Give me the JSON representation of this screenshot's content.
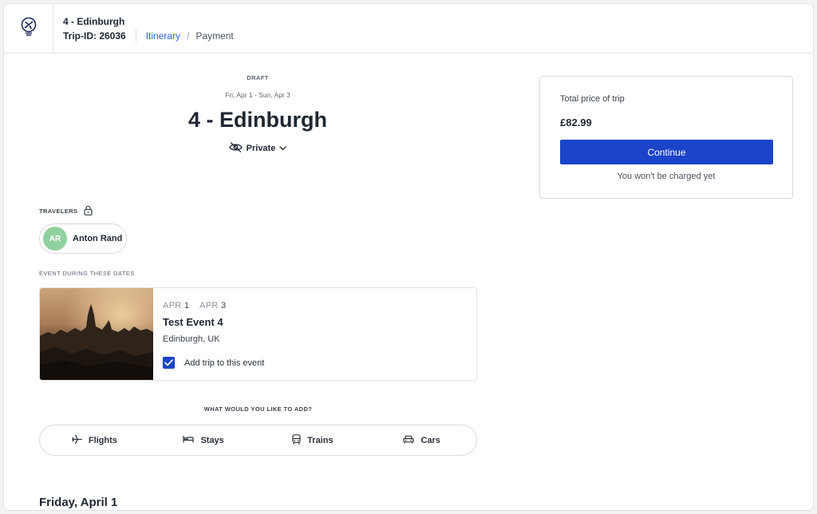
{
  "header": {
    "trip_name": "4 - Edinburgh",
    "trip_id": "Trip-ID: 26036",
    "breadcrumb": {
      "itinerary": "Itinerary",
      "separator": "/",
      "payment": "Payment"
    },
    "logo_icon": "plane-lightbulb-icon"
  },
  "hero": {
    "status": "DRAFT",
    "dates": "Fri, Apr 1 - Sun, Apr 3",
    "title": "4 - Edinburgh",
    "privacy": "Private"
  },
  "travelers": {
    "label": "TRAVELERS",
    "items": [
      {
        "initials": "AR",
        "name": "Anton Rand",
        "avatar_color": "#8fd19e"
      }
    ]
  },
  "event": {
    "label": "EVENT DURING THESE DATES",
    "start_month": "APR",
    "start_day": "1",
    "end_month": "APR",
    "end_day": "3",
    "title": "Test Event 4",
    "location": "Edinburgh, UK",
    "add_label": "Add trip to this event",
    "add_checked": true
  },
  "add": {
    "question": "WHAT WOULD YOU LIKE TO ADD?",
    "options": [
      "Flights",
      "Stays",
      "Trains",
      "Cars"
    ]
  },
  "day_heading": "Friday, April 1",
  "price": {
    "label": "Total price of trip",
    "value": "£82.99",
    "continue_label": "Continue",
    "note": "You won't be charged yet"
  },
  "colors": {
    "primary": "#1b44c8",
    "link": "#2e62d9"
  }
}
